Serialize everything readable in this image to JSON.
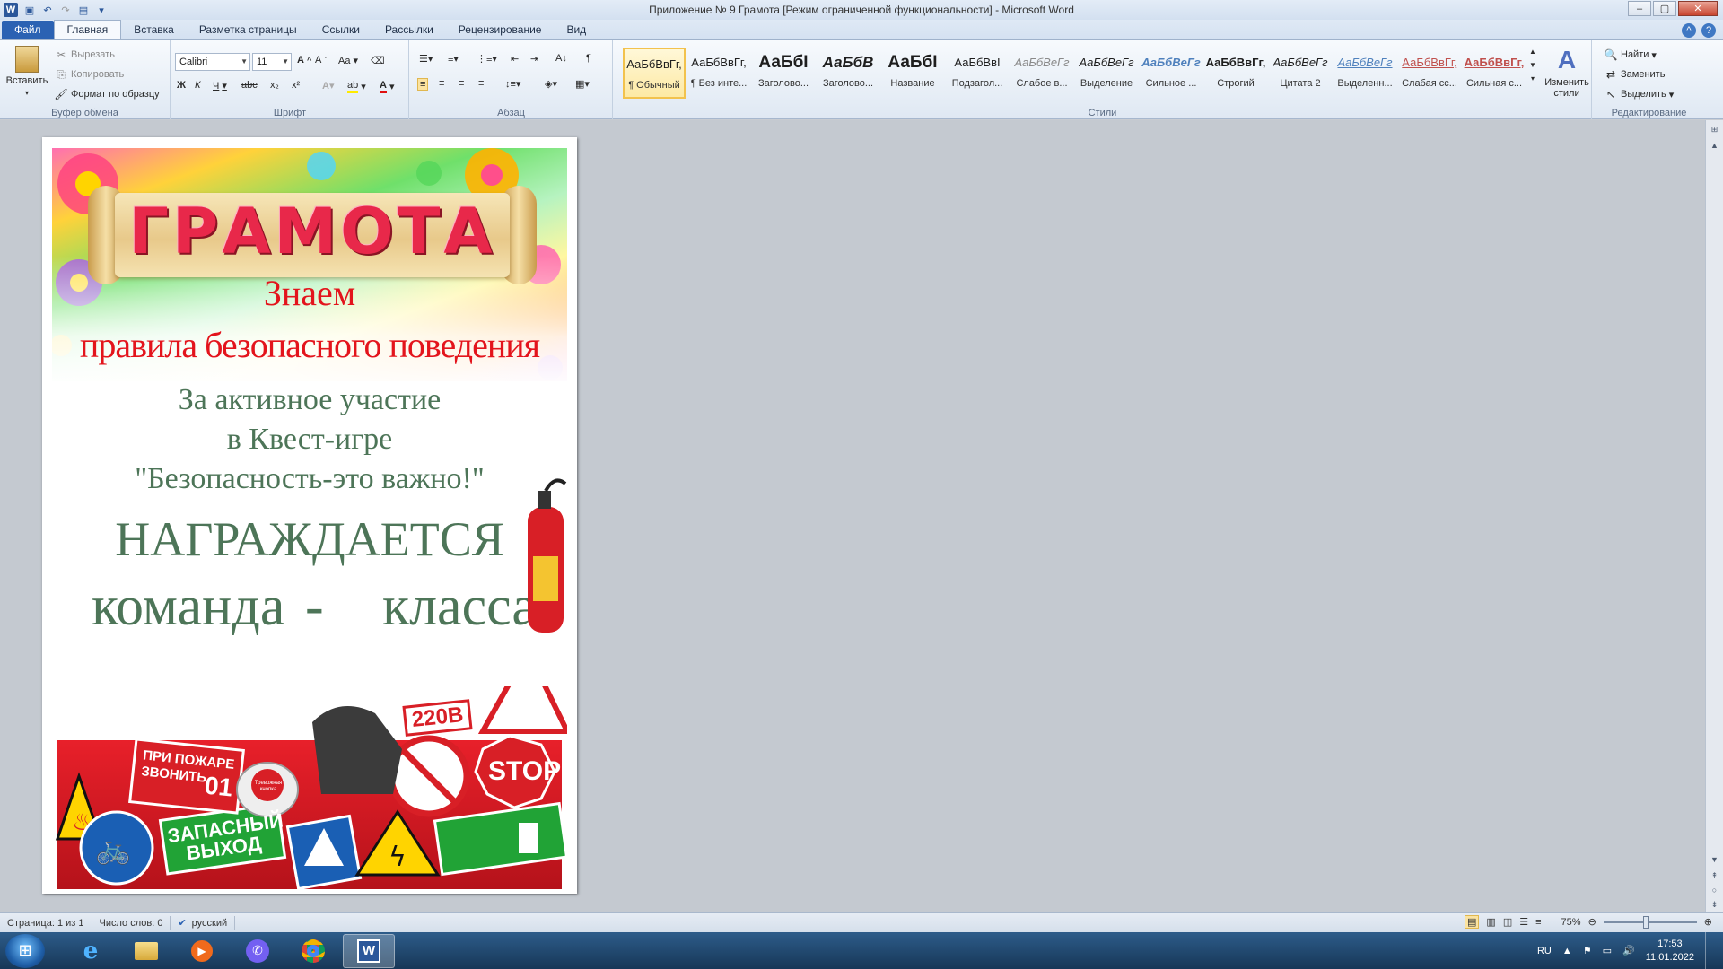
{
  "window": {
    "title": "Приложение № 9  Грамота [Режим ограниченной функциональности]  -  Microsoft Word"
  },
  "tabs": [
    "Файл",
    "Главная",
    "Вставка",
    "Разметка страницы",
    "Ссылки",
    "Рассылки",
    "Рецензирование",
    "Вид"
  ],
  "ribbon": {
    "clipboard": {
      "paste": "Вставить",
      "cut": "Вырезать",
      "copy": "Копировать",
      "format_painter": "Формат по образцу",
      "label": "Буфер обмена"
    },
    "font": {
      "name": "Calibri",
      "size": "11",
      "label": "Шрифт",
      "bold": "Ж",
      "italic": "К",
      "underline": "Ч",
      "strike": "abc",
      "sub": "x₂",
      "sup": "x²",
      "case": "Aa"
    },
    "paragraph": {
      "label": "Абзац"
    },
    "styles": {
      "label": "Стили",
      "items": [
        {
          "preview": "АаБбВвГг,",
          "name": "¶ Обычный"
        },
        {
          "preview": "АаБбВвГг,",
          "name": "¶ Без инте..."
        },
        {
          "preview": "АаБбI",
          "name": "Заголово..."
        },
        {
          "preview": "АаБбВ",
          "name": "Заголово..."
        },
        {
          "preview": "АаБбI",
          "name": "Название"
        },
        {
          "preview": "АаБбВвI",
          "name": "Подзагол..."
        },
        {
          "preview": "АаБбВеГг",
          "name": "Слабое в..."
        },
        {
          "preview": "АаБбВеГг",
          "name": "Выделение"
        },
        {
          "preview": "АаБбВеГг",
          "name": "Сильное ..."
        },
        {
          "preview": "АаБбВвГг,",
          "name": "Строгий"
        },
        {
          "preview": "АаБбВеГг",
          "name": "Цитата 2"
        },
        {
          "preview": "АаБбВеГг",
          "name": "Выделенн..."
        },
        {
          "preview": "АаБбВвГг,",
          "name": "Слабая сс..."
        },
        {
          "preview": "АаБбВвГг,",
          "name": "Сильная с..."
        }
      ],
      "change": "Изменить стили"
    },
    "editing": {
      "label": "Редактирование",
      "find": "Найти",
      "replace": "Заменить",
      "select": "Выделить"
    }
  },
  "document": {
    "title": "ГРАМОТА",
    "line1": "Знаем",
    "line2": "правила безопасного поведения",
    "line3": "За активное участие",
    "line4": "в Квест-игре",
    "line5": "\"Безопасность-это важно!\"",
    "line6": "НАГРАЖДАЕТСЯ",
    "line7a": "команда",
    "line7b": "-",
    "line7c": "класса",
    "signs": {
      "fire": "ПРИ ПОЖАРЕ ЗВОНИТЬ",
      "fire_num": "01",
      "exit": "ЗАПАСНЫЙ ВЫХОД",
      "voltage": "220В",
      "stop": "STOP",
      "alarm": "Тревожная кнопка"
    }
  },
  "status": {
    "page": "Страница: 1 из 1",
    "words": "Число слов: 0",
    "lang": "русский",
    "zoom": "75%"
  },
  "taskbar": {
    "lang": "RU",
    "time": "17:53",
    "date": "11.01.2022"
  },
  "colors": {
    "accent": "#2b62b3",
    "cert_red": "#e3141c",
    "cert_green": "#4d7558"
  }
}
